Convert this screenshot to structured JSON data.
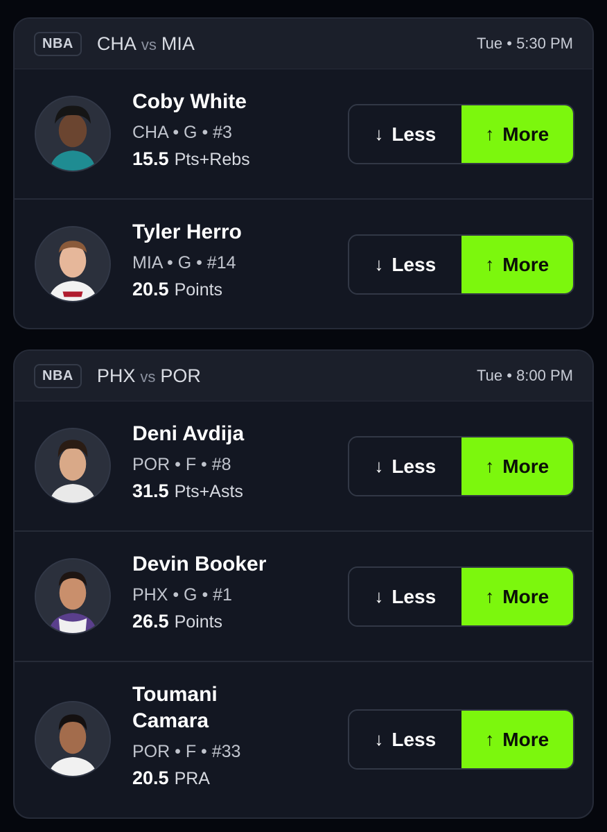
{
  "colors": {
    "background": "#05070d",
    "card": "#131722",
    "header": "#1b1f2a",
    "more_accent": "#7cf70d"
  },
  "games": [
    {
      "league": "NBA",
      "team_a": "CHA",
      "vs": "vs",
      "team_b": "MIA",
      "time": "Tue • 5:30 PM",
      "players": [
        {
          "name": "Coby White",
          "meta": "CHA • G • #3",
          "line_value": "15.5",
          "line_stat": "Pts+Rebs",
          "less_label": "Less",
          "more_label": "More",
          "less_icon": "↓",
          "more_icon": "↑"
        },
        {
          "name": "Tyler Herro",
          "meta": "MIA • G • #14",
          "line_value": "20.5",
          "line_stat": "Points",
          "less_label": "Less",
          "more_label": "More",
          "less_icon": "↓",
          "more_icon": "↑"
        }
      ]
    },
    {
      "league": "NBA",
      "team_a": "PHX",
      "vs": "vs",
      "team_b": "POR",
      "time": "Tue • 8:00 PM",
      "players": [
        {
          "name": "Deni Avdija",
          "meta": "POR • F • #8",
          "line_value": "31.5",
          "line_stat": "Pts+Asts",
          "less_label": "Less",
          "more_label": "More",
          "less_icon": "↓",
          "more_icon": "↑"
        },
        {
          "name": "Devin Booker",
          "meta": "PHX • G • #1",
          "line_value": "26.5",
          "line_stat": "Points",
          "less_label": "Less",
          "more_label": "More",
          "less_icon": "↓",
          "more_icon": "↑"
        },
        {
          "name": "Toumani Camara",
          "meta": "POR • F • #33",
          "line_value": "20.5",
          "line_stat": "PRA",
          "less_label": "Less",
          "more_label": "More",
          "less_icon": "↓",
          "more_icon": "↑"
        }
      ]
    }
  ]
}
